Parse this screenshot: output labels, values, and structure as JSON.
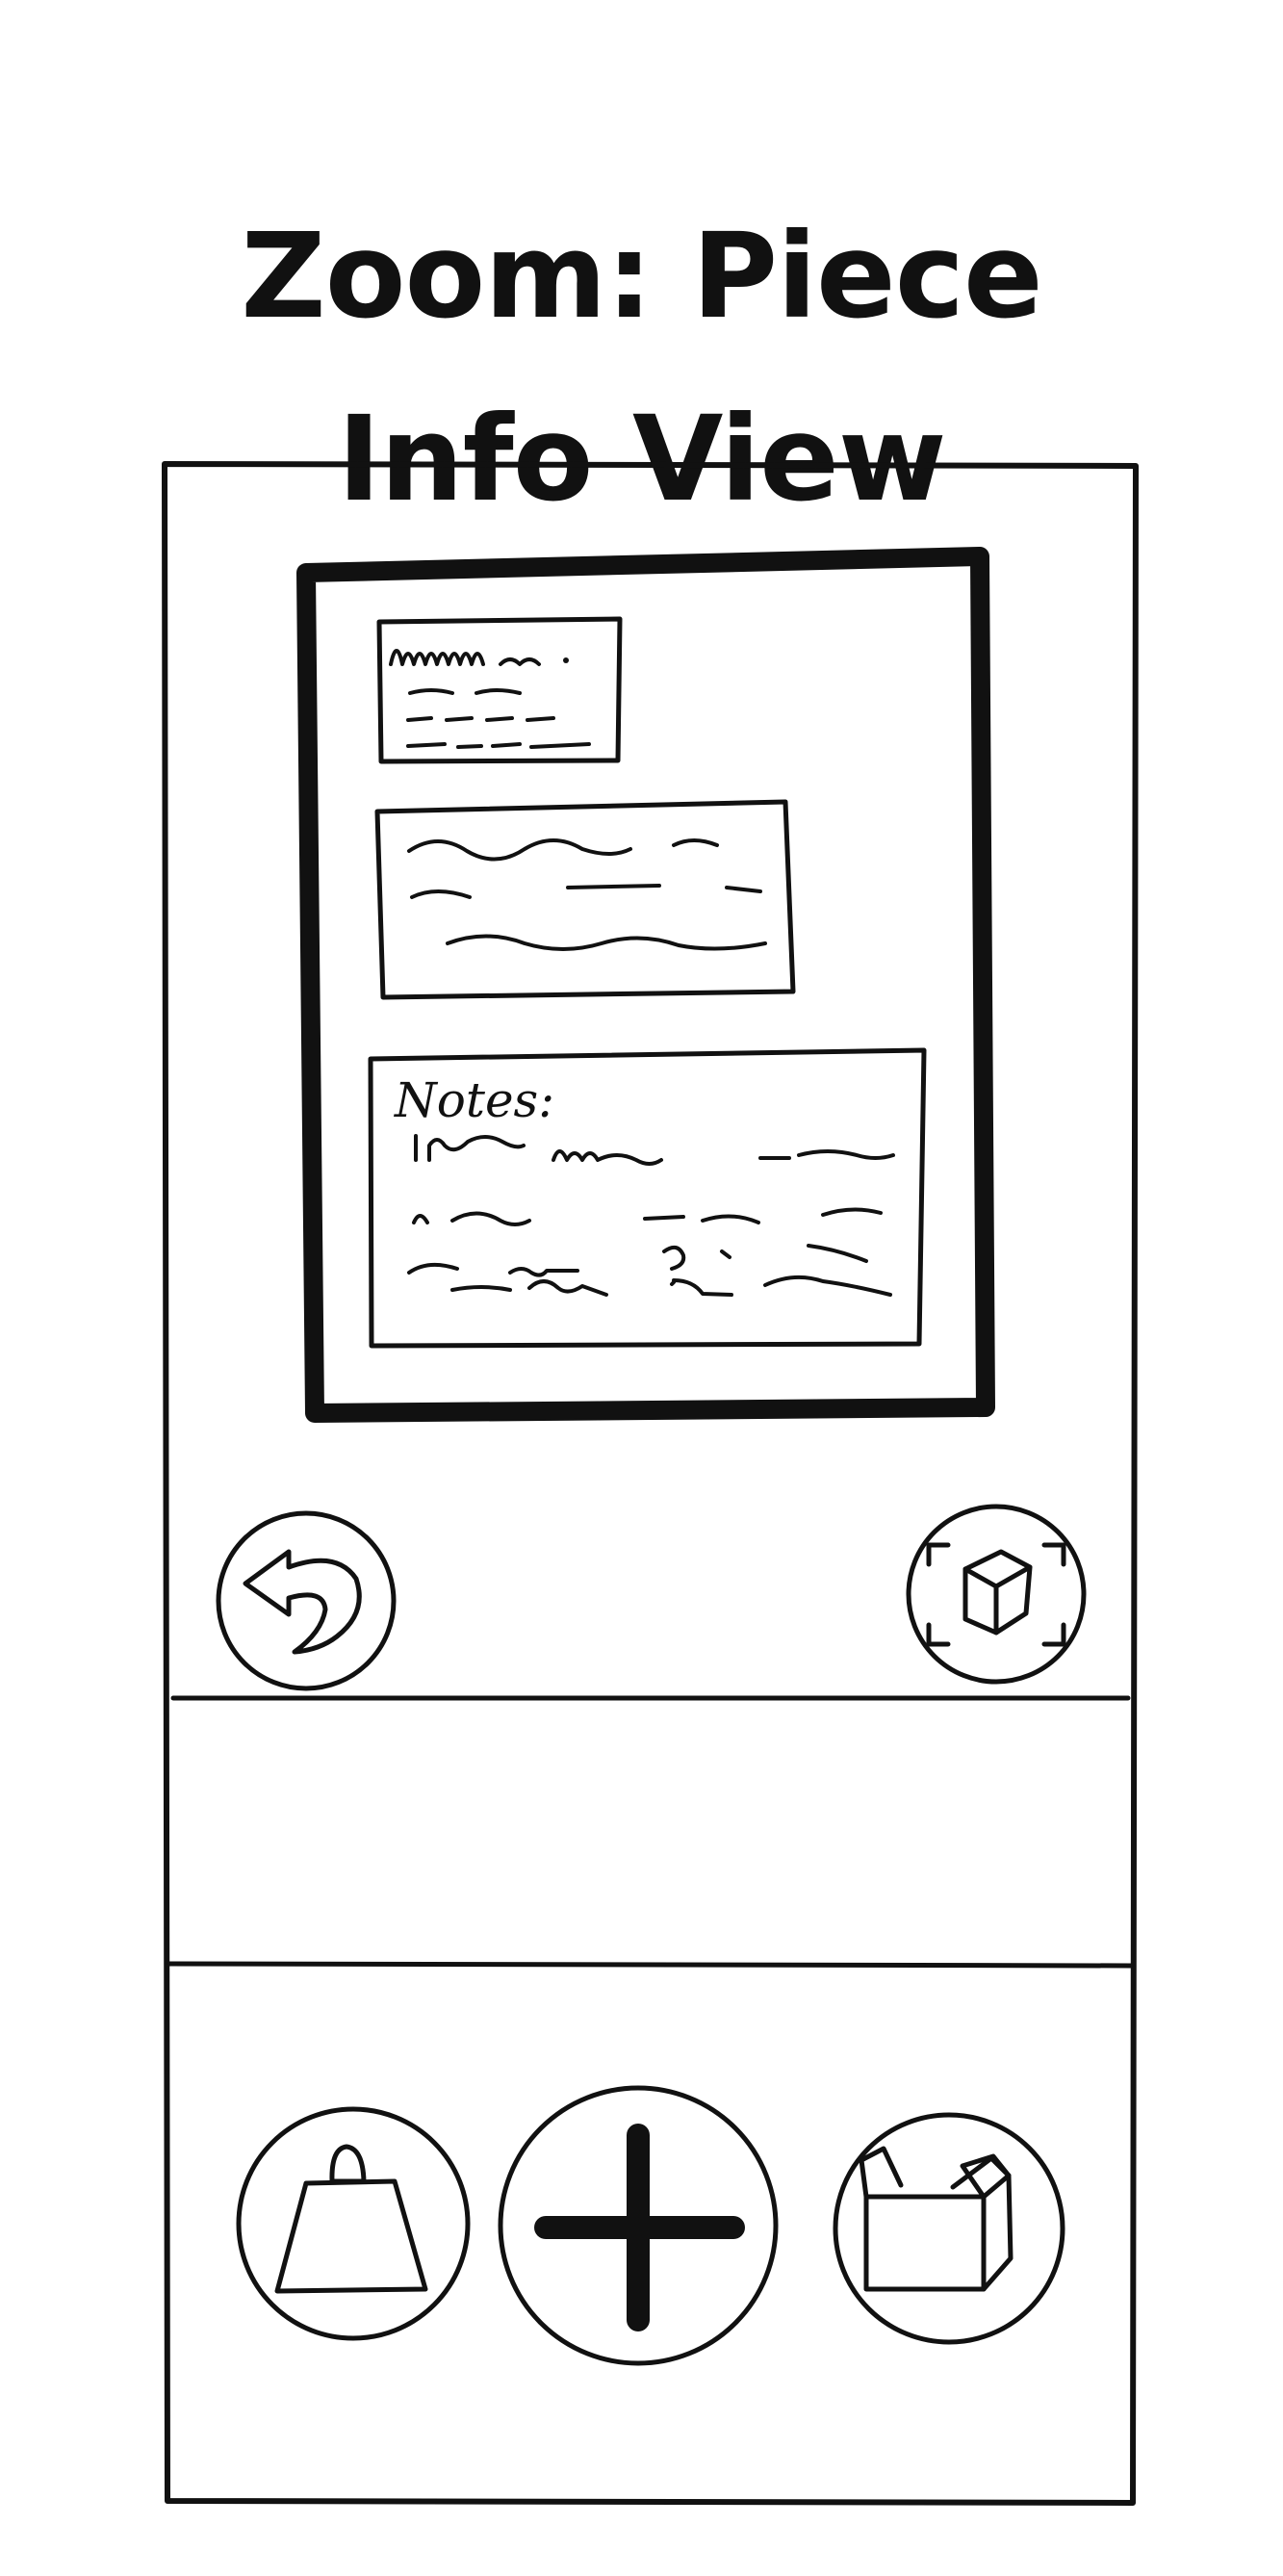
{
  "title": {
    "line1": "Zoom: Piece",
    "line2": "Info View"
  },
  "info_card": {
    "notes_label": "Notes:"
  },
  "icons": {
    "back": "back-arrow-icon",
    "ar_view": "ar-cube-scan-icon",
    "weight": "weight-icon",
    "add": "plus-icon",
    "open_box": "open-box-icon"
  },
  "colors": {
    "ink": "#111111",
    "paper": "#ffffff"
  }
}
